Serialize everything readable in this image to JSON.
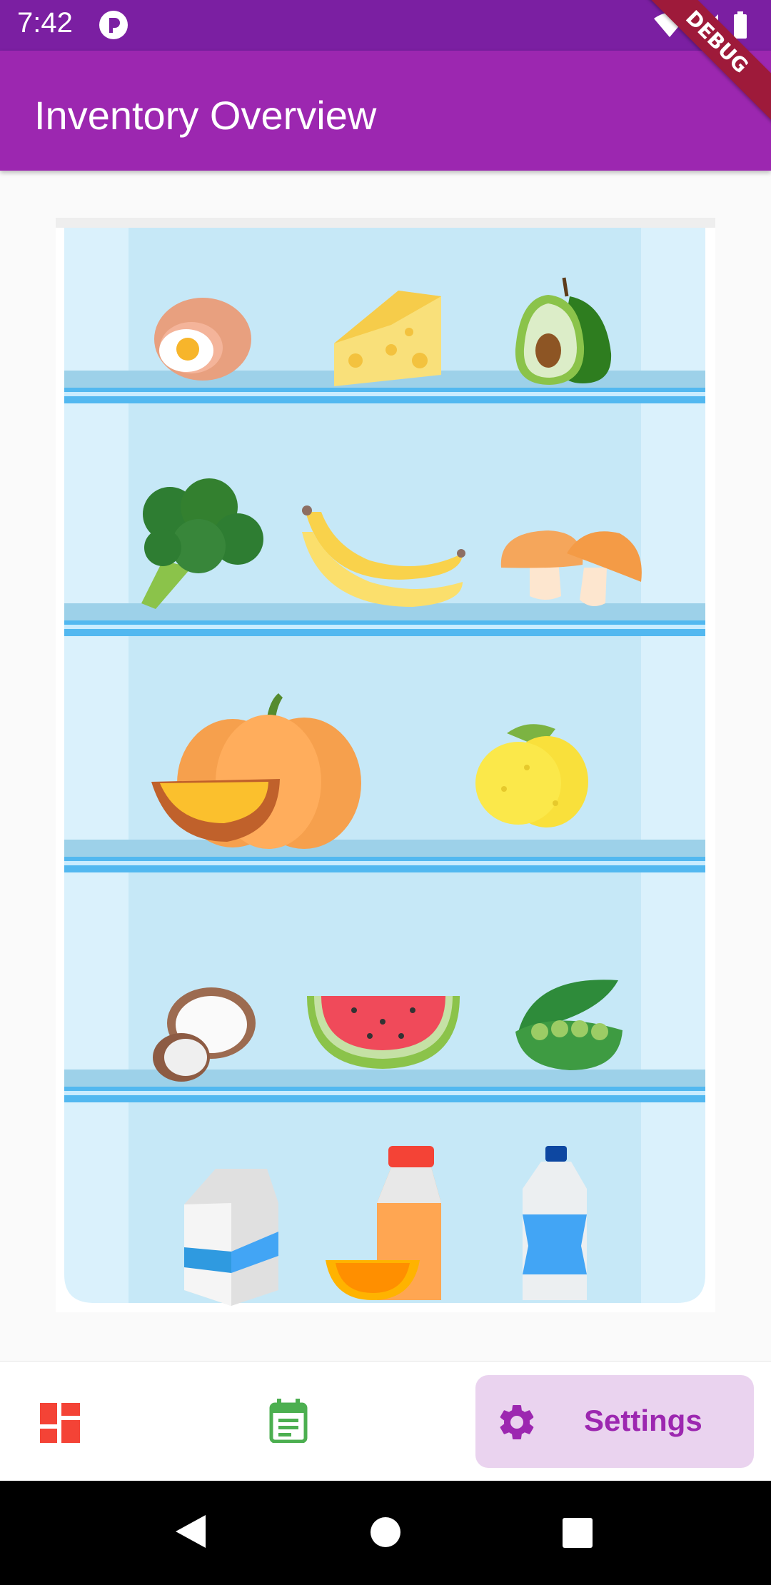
{
  "status_bar": {
    "time": "7:42",
    "icons": [
      "app-notification-icon",
      "wifi-icon",
      "signal-icon",
      "battery-icon"
    ]
  },
  "app_bar": {
    "title": "Inventory Overview",
    "debug_banner": "DEBUG"
  },
  "fridge": {
    "shelves": [
      {
        "items": [
          "egg",
          "cheese",
          "avocado"
        ]
      },
      {
        "items": [
          "broccoli",
          "banana",
          "mushroom"
        ]
      },
      {
        "items": [
          "pumpkin",
          "lemon"
        ]
      },
      {
        "items": [
          "coconut",
          "watermelon",
          "peas"
        ]
      },
      {
        "items": [
          "milk",
          "orange-juice",
          "water-bottle"
        ]
      }
    ]
  },
  "bottom_nav": {
    "items": [
      {
        "icon": "dashboard-icon",
        "label": "",
        "selected": false,
        "color": "#f44336"
      },
      {
        "icon": "calendar-note-icon",
        "label": "",
        "selected": false,
        "color": "#4caf50"
      },
      {
        "icon": "gear-icon",
        "label": "Settings",
        "selected": true,
        "color": "#9c27b0"
      }
    ]
  },
  "colors": {
    "status_bar": "#7b1fa2",
    "app_bar": "#9c27b0",
    "selected_tab_bg": "#ead3ef",
    "fridge_interior": "#c6e8f7"
  }
}
